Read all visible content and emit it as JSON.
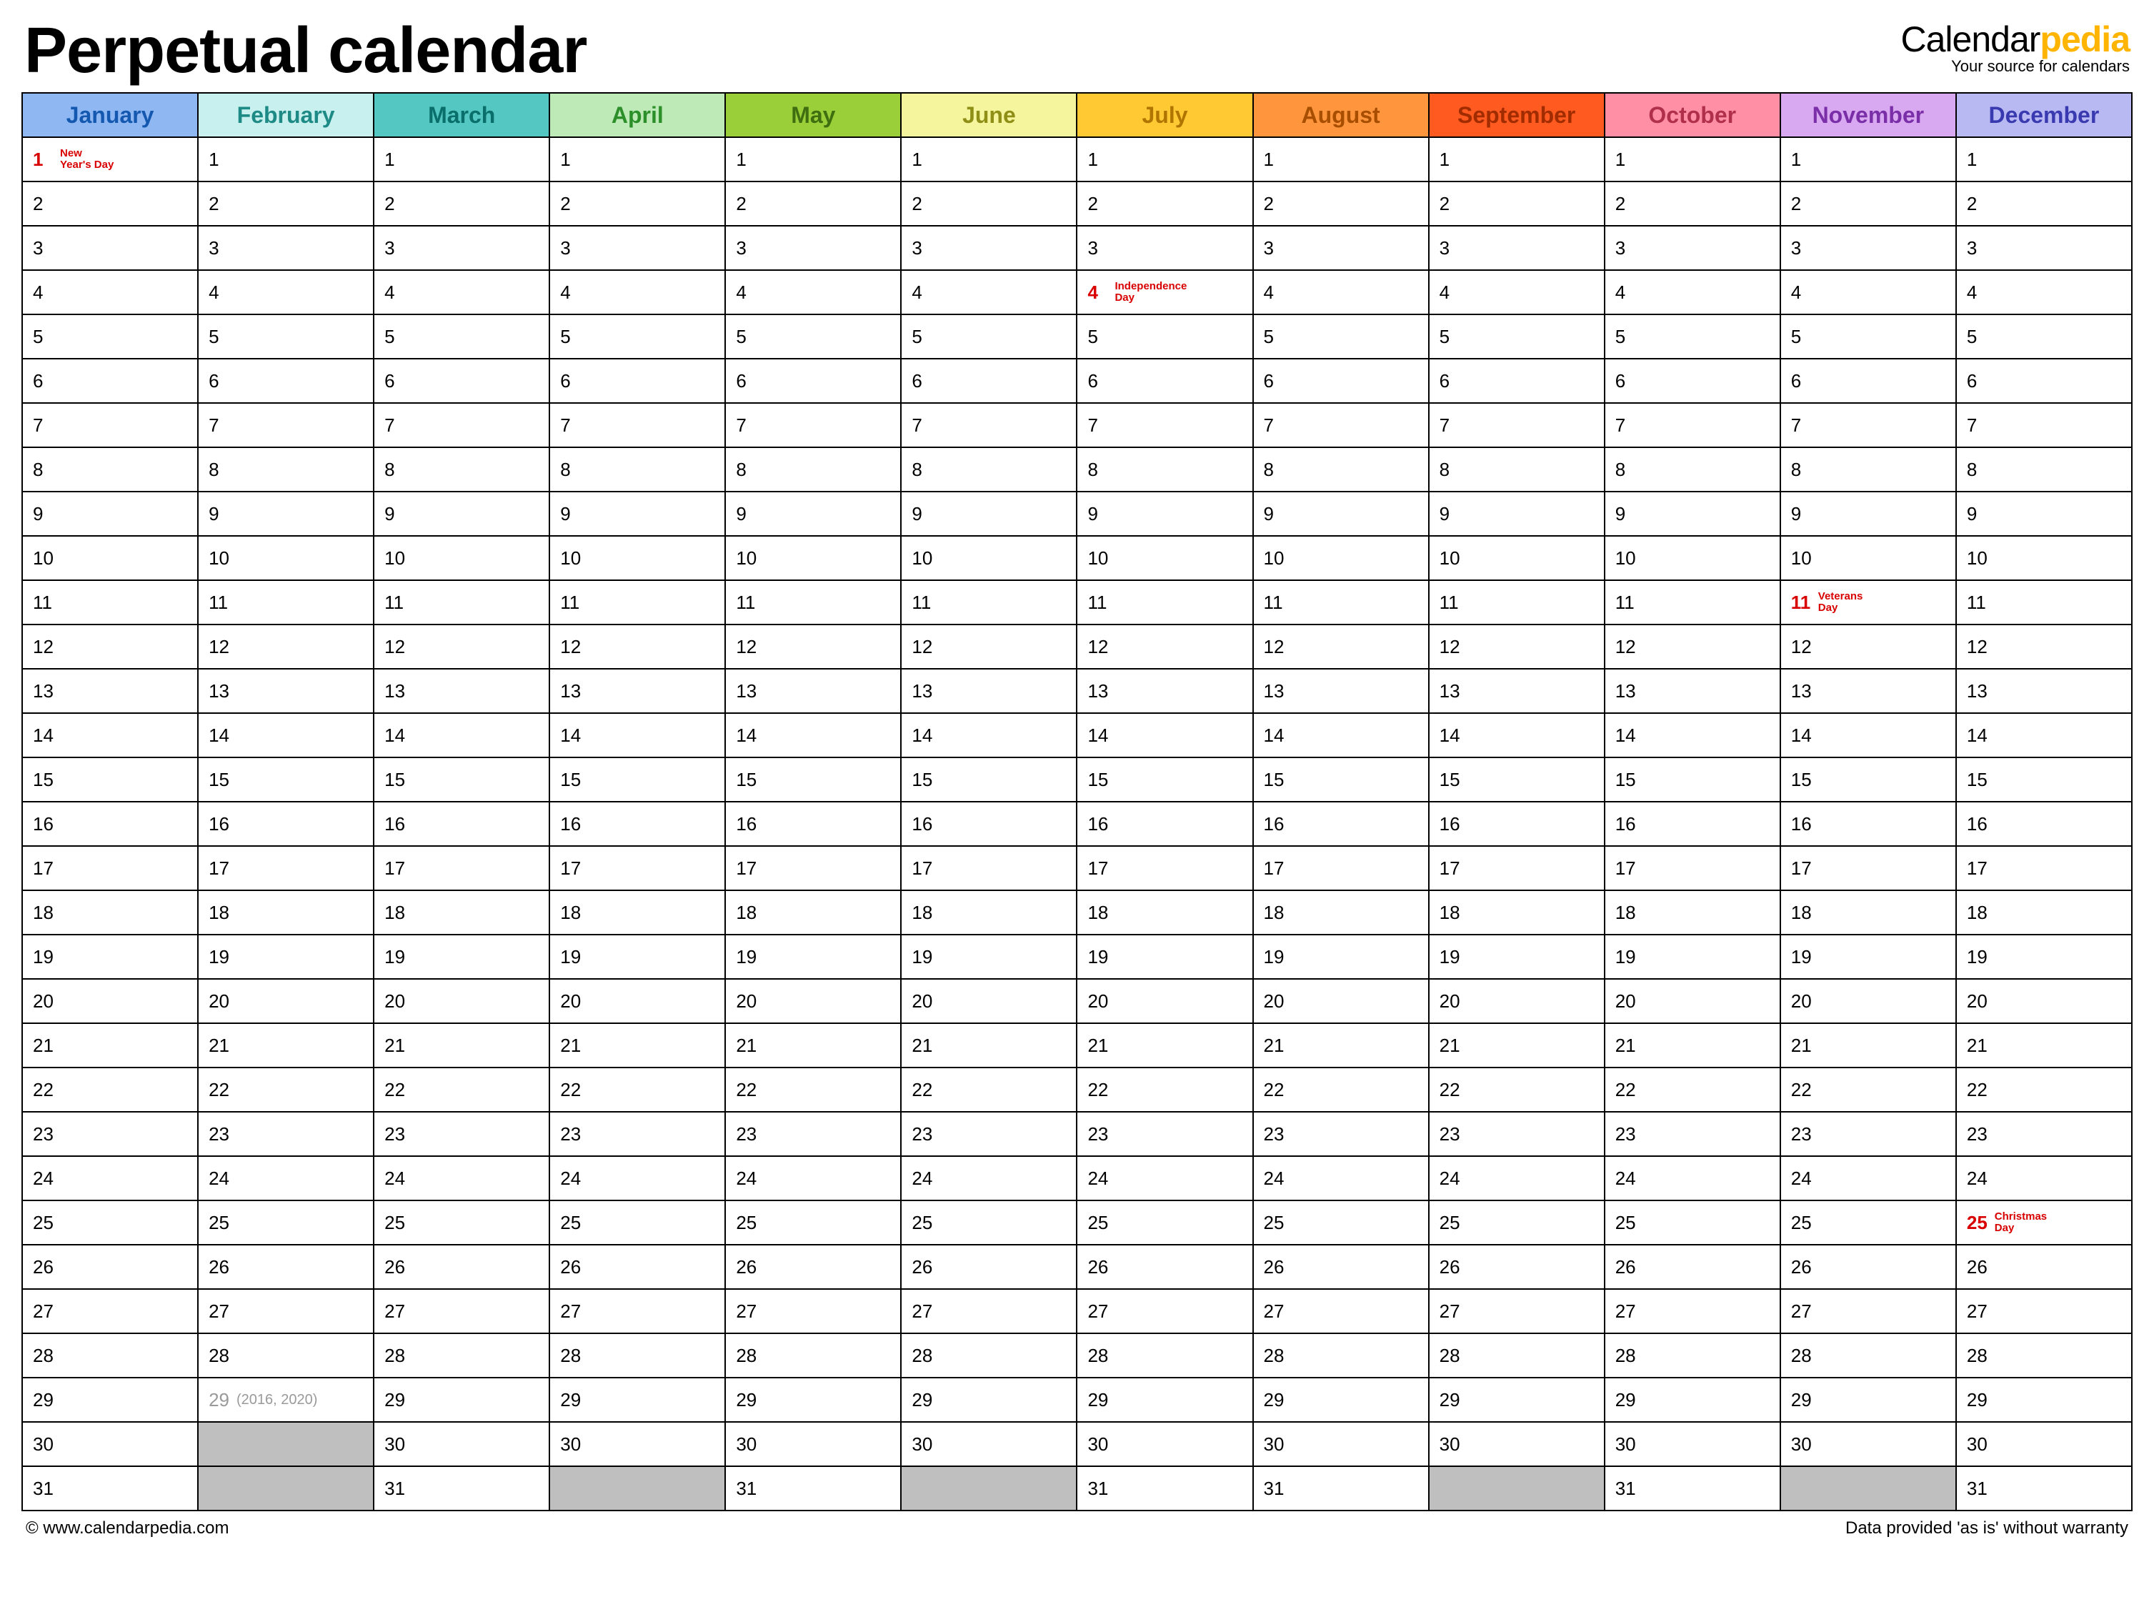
{
  "header": {
    "title": "Perpetual calendar",
    "brand_part1": "Calendar",
    "brand_part2": "pedia",
    "brand_tagline": "Your source for calendars"
  },
  "months": [
    {
      "name": "January",
      "color": "#8FB8F2",
      "text": "#1558B0",
      "days": 31,
      "holidays": {
        "1": "New Year's Day"
      }
    },
    {
      "name": "February",
      "color": "#C7F0EE",
      "text": "#1E8A86",
      "days": 28,
      "leap": {
        "day": 29,
        "note": "(2016, 2020)"
      }
    },
    {
      "name": "March",
      "color": "#55C7C2",
      "text": "#0A6E6A",
      "days": 31
    },
    {
      "name": "April",
      "color": "#BEEAB8",
      "text": "#2D8F2A",
      "days": 30
    },
    {
      "name": "May",
      "color": "#9ACF3A",
      "text": "#3E6E0F",
      "days": 31
    },
    {
      "name": "June",
      "color": "#F4F59C",
      "text": "#8F8F18",
      "days": 30
    },
    {
      "name": "July",
      "color": "#FFC933",
      "text": "#B07400",
      "days": 31,
      "holidays": {
        "4": "Independence Day"
      }
    },
    {
      "name": "August",
      "color": "#FF963D",
      "text": "#A84E00",
      "days": 31
    },
    {
      "name": "September",
      "color": "#FF5A1F",
      "text": "#A02C00",
      "days": 30
    },
    {
      "name": "October",
      "color": "#FF8FA4",
      "text": "#B0304B",
      "days": 31
    },
    {
      "name": "November",
      "color": "#D8A8F0",
      "text": "#7A2FA8",
      "days": 30,
      "holidays": {
        "11": "Veterans Day"
      }
    },
    {
      "name": "December",
      "color": "#B8B8F2",
      "text": "#3A3AB0",
      "days": 31,
      "holidays": {
        "25": "Christmas Day"
      }
    }
  ],
  "max_rows": 31,
  "footer": {
    "left": "© www.calendarpedia.com",
    "right": "Data provided 'as is' without warranty"
  }
}
